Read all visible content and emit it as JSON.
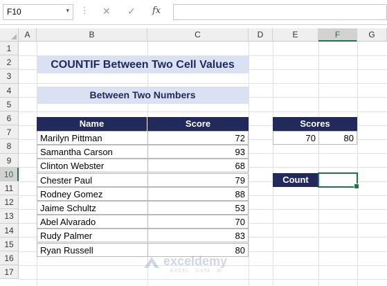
{
  "formula_bar": {
    "name_box": "F10",
    "name_box_arrow": "▾",
    "dots": "⋮",
    "cancel_icon": "✕",
    "enter_icon": "✓",
    "fx_label": "fx",
    "formula": ""
  },
  "columns": [
    "A",
    "B",
    "C",
    "D",
    "E",
    "F",
    "G"
  ],
  "rows": [
    "1",
    "2",
    "3",
    "4",
    "5",
    "6",
    "7",
    "8",
    "9",
    "10",
    "11",
    "12",
    "13",
    "14",
    "15",
    "16",
    "17"
  ],
  "selected_column": "F",
  "selected_row": "10",
  "titles": {
    "main": "COUNTIF Between Two Cell Values",
    "sub": "Between Two Numbers"
  },
  "table": {
    "headers": [
      "Name",
      "Score"
    ],
    "rows": [
      [
        "Marilyn Pittman",
        "72"
      ],
      [
        "Samantha Carson",
        "93"
      ],
      [
        "Clinton Webster",
        "68"
      ],
      [
        "Chester Paul",
        "79"
      ],
      [
        "Rodney Gomez",
        "88"
      ],
      [
        "Jaime Schultz",
        "53"
      ],
      [
        "Abel Alvarado",
        "70"
      ],
      [
        "Rudy Palmer",
        "83"
      ],
      [
        "Ryan Russell",
        "80"
      ]
    ]
  },
  "scores": {
    "header": "Scores",
    "low": "70",
    "high": "80"
  },
  "count": {
    "label": "Count",
    "value": ""
  },
  "watermark": {
    "name": "exceldemy",
    "tagline": "EXCEL · DATA · BI"
  },
  "colors": {
    "header_dark": "#222a5c",
    "title_band": "#d9e1f2",
    "selection": "#217346"
  }
}
